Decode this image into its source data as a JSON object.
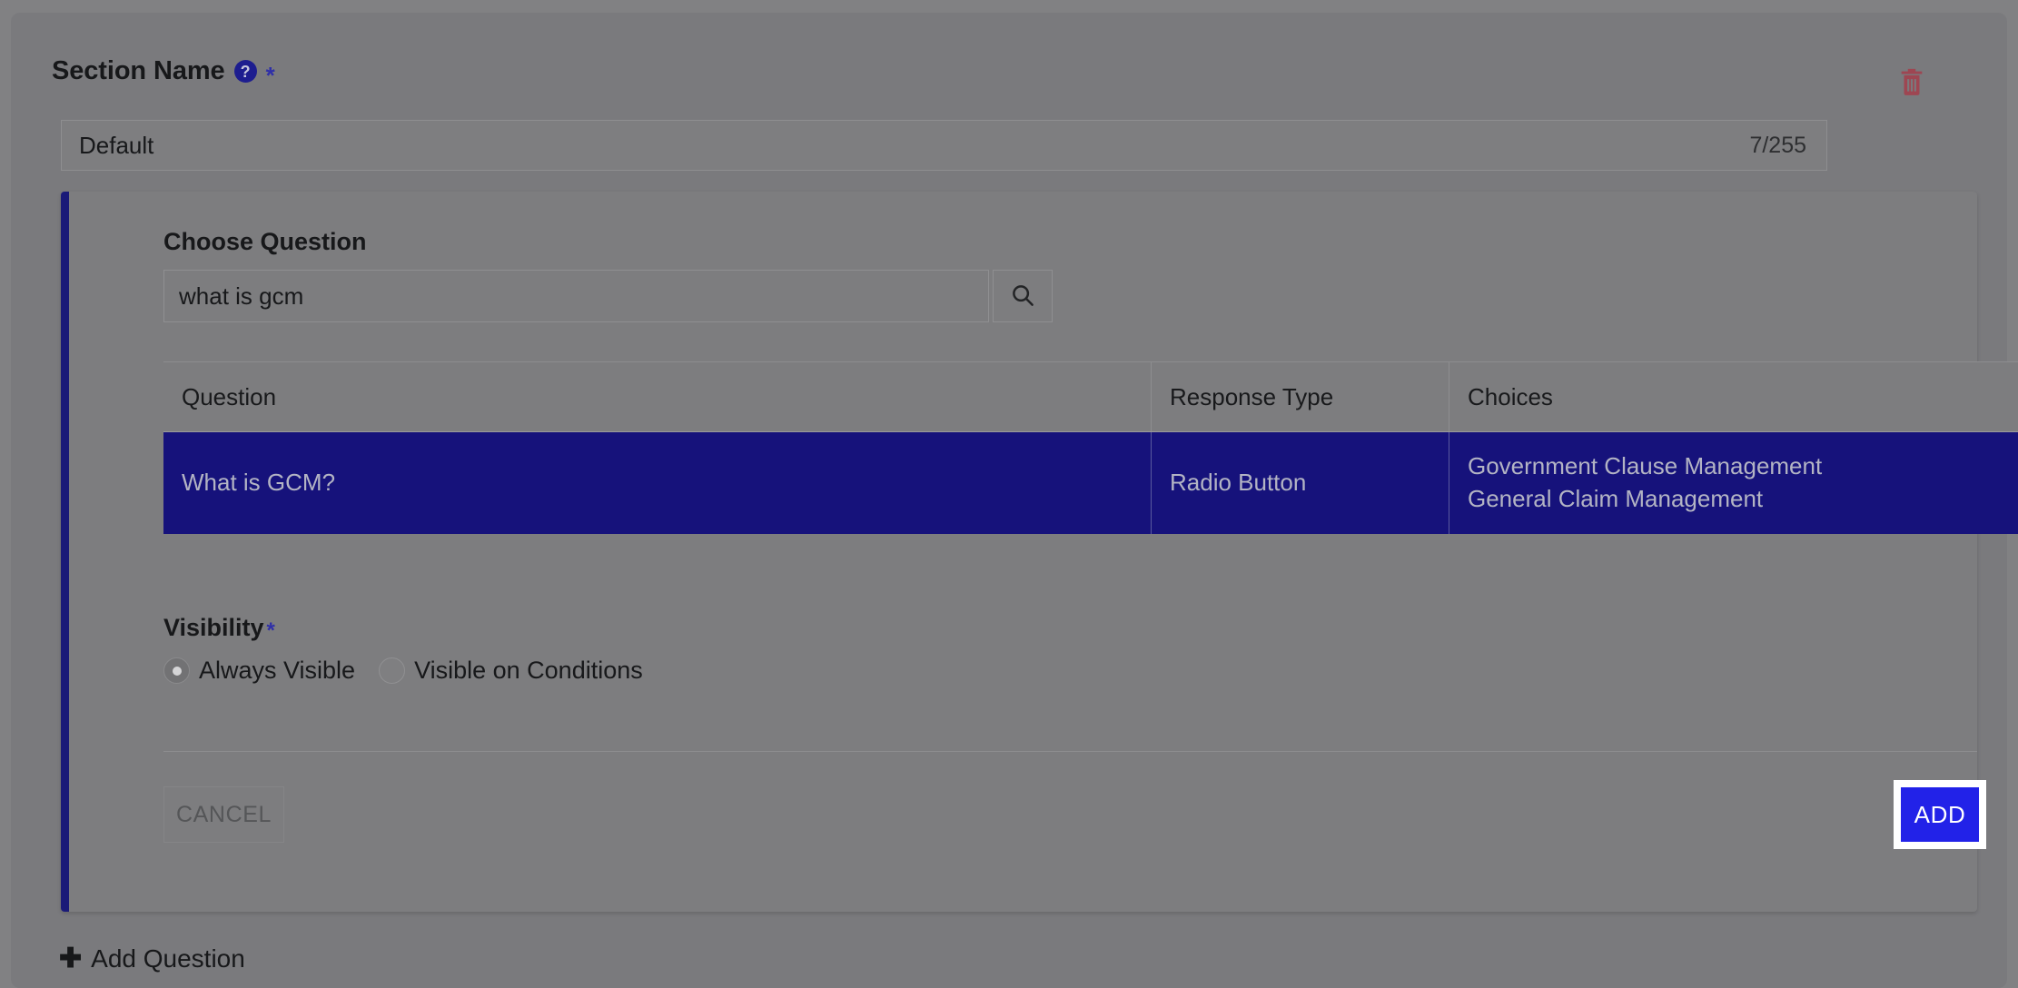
{
  "section": {
    "title": "Section Name",
    "help_icon": "help-circle-icon",
    "required_marker": "*",
    "delete_icon": "trash-icon",
    "name_value": "Default",
    "name_placeholder": "Section Name",
    "char_counter": "7/255"
  },
  "question_card": {
    "choose_label": "Choose Question",
    "search_value": "what is gcm",
    "search_placeholder": "Search question",
    "search_icon": "search-icon",
    "table": {
      "headers": [
        "Question",
        "Response Type",
        "Choices"
      ],
      "rows": [
        {
          "question": "What is GCM?",
          "response_type": "Radio Button",
          "choices": "Government Clause Management\nGeneral Claim Management",
          "selected": true
        }
      ]
    },
    "visibility": {
      "label": "Visibility",
      "required_marker": "*",
      "options": [
        {
          "label": "Always Visible",
          "checked": true
        },
        {
          "label": "Visible on Conditions",
          "checked": false
        }
      ]
    },
    "cancel_label": "CANCEL",
    "add_label": "ADD"
  },
  "footer": {
    "add_question_icon": "plus-icon",
    "add_question_label": "Add Question"
  },
  "colors": {
    "accent_navy": "#1a1a78",
    "selected_row": "#16127b",
    "primary_button": "#2222e8",
    "delete_red": "#9e4652",
    "required_star": "#2f2fa8",
    "overlay_gray": "#7d7d7f"
  }
}
